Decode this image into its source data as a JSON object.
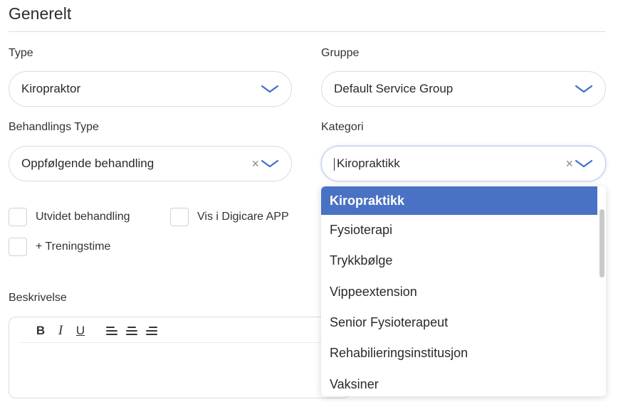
{
  "section": {
    "title": "Generelt"
  },
  "fields": {
    "type": {
      "label": "Type",
      "value": "Kiropraktor"
    },
    "gruppe": {
      "label": "Gruppe",
      "value": "Default Service Group"
    },
    "behandlings_type": {
      "label": "Behandlings Type",
      "value": "Oppfølgende behandling",
      "clear": "×"
    },
    "kategori": {
      "label": "Kategori",
      "value": "Kiropraktikk",
      "clear": "×"
    }
  },
  "checkboxes": {
    "utvidet": {
      "label": "Utvidet behandling",
      "checked": false
    },
    "digicare": {
      "label": "Vis i Digicare APP",
      "checked": false
    },
    "trening": {
      "label": "+ Treningstime",
      "checked": false
    }
  },
  "description": {
    "label": "Beskrivelse",
    "toolbar": {
      "bold": "B",
      "italic": "I",
      "underline": "U"
    }
  },
  "dropdown": {
    "options": [
      "Kiropraktikk",
      "Fysioterapi",
      "Trykkbølge",
      "Vippeextension",
      "Senior Fysioterapeut",
      "Rehabilieringsinstitusjon",
      "Vaksiner"
    ],
    "selected_index": 0
  },
  "colors": {
    "accent": "#4a72c4",
    "chevron": "#3f6ec8"
  },
  "icons": [
    "chevron-down-icon",
    "clear-icon",
    "bold-icon",
    "italic-icon",
    "underline-icon",
    "align-left-icon",
    "align-center-icon",
    "align-right-icon"
  ]
}
